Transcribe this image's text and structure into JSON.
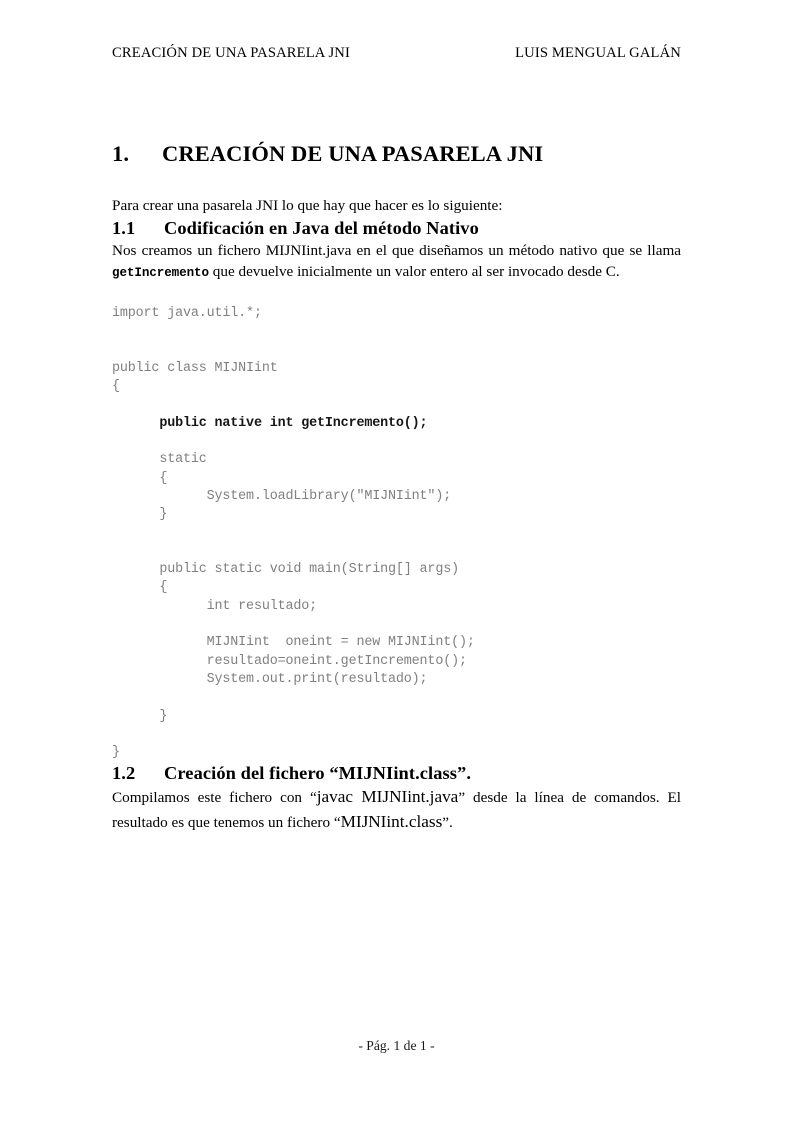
{
  "header": {
    "left": "CREACIÓN DE UNA PASARELA JNI",
    "right": "LUIS MENGUAL GALÁN"
  },
  "chapter": {
    "number": "1.",
    "title": "CREACIÓN DE UNA PASARELA JNI"
  },
  "intro": {
    "paragraph": "Para crear una pasarela JNI lo que hay que hacer es lo siguiente:"
  },
  "section_11": {
    "number": "1.1",
    "title": "Codificación en Java del método Nativo",
    "par_part1": "Nos creamos un fichero MIJNIint.java en el que diseñamos un  método nativo que se llama ",
    "par_code": "getIncremento",
    "par_part2": " que devuelve inicialmente un valor entero al ser invocado desde C."
  },
  "code_listing": {
    "language": "java",
    "lines": [
      {
        "text": "import java.util.*;",
        "emphasis": false
      },
      {
        "text": "",
        "emphasis": false
      },
      {
        "text": "",
        "emphasis": false
      },
      {
        "text": "public class MIJNIint",
        "emphasis": false
      },
      {
        "text": "{",
        "emphasis": false
      },
      {
        "text": "",
        "emphasis": false
      },
      {
        "text": "      public native int getIncremento();",
        "emphasis": true
      },
      {
        "text": "",
        "emphasis": false
      },
      {
        "text": "      static",
        "emphasis": false
      },
      {
        "text": "      {",
        "emphasis": false
      },
      {
        "text": "            System.loadLibrary(\"MIJNIint\");",
        "emphasis": false
      },
      {
        "text": "      }",
        "emphasis": false
      },
      {
        "text": "",
        "emphasis": false
      },
      {
        "text": "",
        "emphasis": false
      },
      {
        "text": "      public static void main(String[] args)",
        "emphasis": false
      },
      {
        "text": "      {",
        "emphasis": false
      },
      {
        "text": "            int resultado;",
        "emphasis": false
      },
      {
        "text": "",
        "emphasis": false
      },
      {
        "text": "            MIJNIint  oneint = new MIJNIint();",
        "emphasis": false
      },
      {
        "text": "            resultado=oneint.getIncremento();",
        "emphasis": false
      },
      {
        "text": "            System.out.print(resultado);",
        "emphasis": false
      },
      {
        "text": "",
        "emphasis": false
      },
      {
        "text": "      }",
        "emphasis": false
      },
      {
        "text": "",
        "emphasis": false
      },
      {
        "text": "}",
        "emphasis": false
      }
    ]
  },
  "section_12": {
    "number": "1.2",
    "title": "Creación del fichero “MIJNIint.class”.",
    "par_part1": "Compilamos este fichero con “",
    "par_big1": "javac MIJNIint.java",
    "par_part2": "” desde la línea de comandos. El resultado es que tenemos un fichero “",
    "par_big2": "MIJNIint.class",
    "par_part3": "”."
  },
  "footer": {
    "text": "- Pág. 1 de 1 -"
  },
  "colors": {
    "text": "#000000",
    "code": "#808080",
    "code_emphasis": "#161616",
    "page_background": "#ffffff"
  }
}
